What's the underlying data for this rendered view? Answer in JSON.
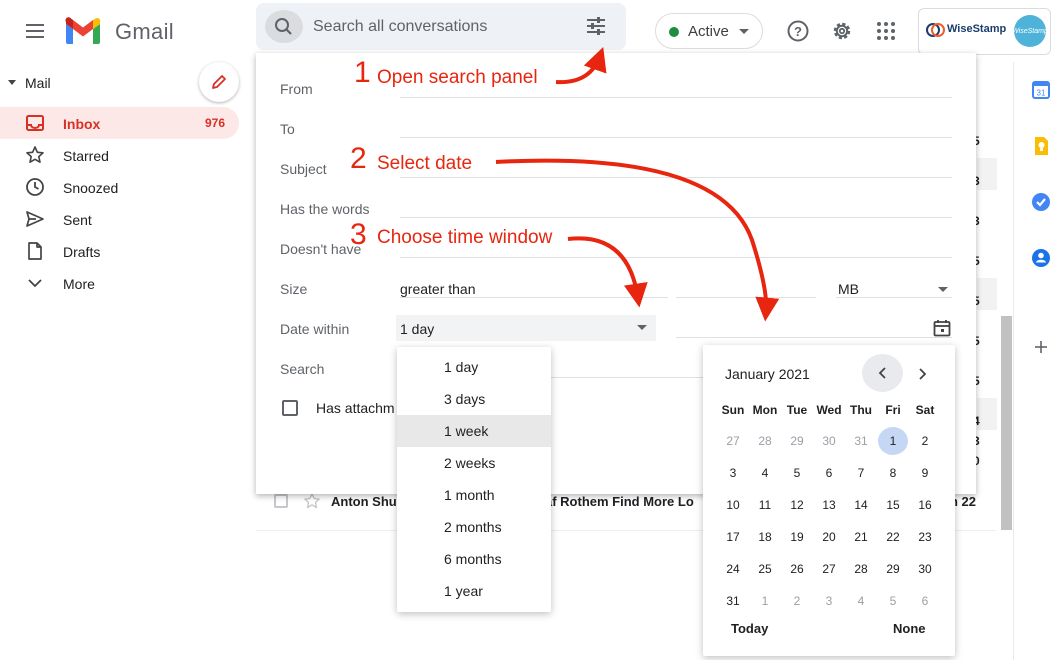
{
  "header": {
    "app_name": "Gmail",
    "search_placeholder": "Search all conversations",
    "status": "Active",
    "brand_text": "WiseStamp",
    "avatar_text": "WiseStamp"
  },
  "sidebar": {
    "section": "Mail",
    "items": [
      {
        "label": "Inbox",
        "count": "976",
        "icon": "inbox-icon"
      },
      {
        "label": "Starred",
        "icon": "star-icon"
      },
      {
        "label": "Snoozed",
        "icon": "clock-icon"
      },
      {
        "label": "Sent",
        "icon": "send-icon"
      },
      {
        "label": "Drafts",
        "icon": "draft-icon"
      },
      {
        "label": "More",
        "icon": "chevron-down-icon"
      }
    ]
  },
  "search_panel": {
    "fields": [
      {
        "label": "From"
      },
      {
        "label": "To"
      },
      {
        "label": "Subject"
      },
      {
        "label": "Has the words"
      },
      {
        "label": "Doesn't have"
      },
      {
        "label": "Size"
      },
      {
        "label": "Date within"
      },
      {
        "label": "Search"
      }
    ],
    "size_operator": "greater than",
    "size_unit": "MB",
    "date_within_value": "1 day",
    "has_attachment_label": "Has attachm"
  },
  "date_range_menu": {
    "options": [
      "1 day",
      "3 days",
      "1 week",
      "2 weeks",
      "1 month",
      "2 months",
      "6 months",
      "1 year"
    ],
    "highlighted": "1 week"
  },
  "datepicker": {
    "month_label": "January 2021",
    "weekdays": [
      "Sun",
      "Mon",
      "Tue",
      "Wed",
      "Thu",
      "Fri",
      "Sat"
    ],
    "weeks": [
      [
        "27",
        "28",
        "29",
        "30",
        "31",
        "1",
        "2"
      ],
      [
        "3",
        "4",
        "5",
        "6",
        "7",
        "8",
        "9"
      ],
      [
        "10",
        "11",
        "12",
        "13",
        "14",
        "15",
        "16"
      ],
      [
        "17",
        "18",
        "19",
        "20",
        "21",
        "22",
        "23"
      ],
      [
        "24",
        "25",
        "26",
        "27",
        "28",
        "29",
        "30"
      ],
      [
        "31",
        "1",
        "2",
        "3",
        "4",
        "5",
        "6"
      ]
    ],
    "selected_day": "1",
    "today_label": "Today",
    "none_label": "None"
  },
  "mail_row": {
    "sender": "Anton Shu",
    "subject": "af Rothem Find More Lo",
    "date": "n 22"
  },
  "list_fragments": [
    "5",
    "3",
    "3",
    "5",
    "5",
    "5",
    "5",
    "4",
    "3",
    "0"
  ],
  "annotations": [
    {
      "number": "1",
      "text": "Open search panel"
    },
    {
      "number": "2",
      "text": "Select date"
    },
    {
      "number": "3",
      "text": "Choose time window"
    }
  ],
  "colors": {
    "accent_red": "#d93025",
    "annotation_red": "#e8250e",
    "active_green": "#1e8e3e",
    "selected_day_blue": "#c6d7f5"
  }
}
